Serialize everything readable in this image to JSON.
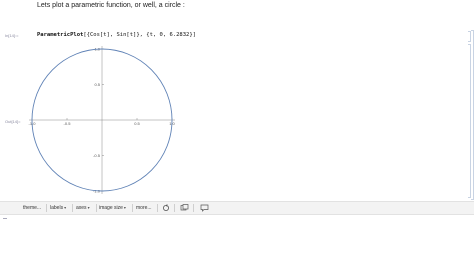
{
  "intro": {
    "text": "Lets plot a parametric function, or well, a circle :"
  },
  "input": {
    "label": "In[14]:=",
    "code_head": "ParametricPlot",
    "code_rest": "[{Cos[t], Sin[t]}, {t, 0, 6.2832}]"
  },
  "output": {
    "label": "Out[14]="
  },
  "chart_data": {
    "type": "line",
    "series": [
      {
        "x": [
          1,
          0.924,
          0.707,
          0.383,
          0,
          -0.383,
          -0.707,
          -0.924,
          -1,
          -0.924,
          -0.707,
          -0.383,
          0,
          0.383,
          0.707,
          0.924,
          1
        ],
        "y": [
          0,
          0.383,
          0.707,
          0.924,
          1,
          0.924,
          0.707,
          0.383,
          0,
          -0.383,
          -0.707,
          -0.924,
          -1,
          -0.924,
          -0.707,
          -0.383,
          0
        ]
      }
    ],
    "xlim": [
      -1,
      1
    ],
    "ylim": [
      -1,
      1
    ],
    "xticks": [
      -1.0,
      -0.5,
      0.5,
      1.0
    ],
    "yticks": [
      -1.0,
      -0.5,
      0.5,
      1.0
    ],
    "xtick_labels": [
      "-1.0",
      "-0.5",
      "0.5",
      "1.0"
    ],
    "ytick_labels": [
      "-1.0",
      "-0.5",
      "0.5",
      "1.0"
    ],
    "title": "",
    "xlabel": "",
    "ylabel": "",
    "grid": false,
    "line_color": "#5e81b5"
  },
  "toolbar": {
    "theme": "theme...",
    "labels": "labels",
    "axes": "axes",
    "image_size": "image size",
    "more": "more..."
  },
  "colors": {
    "curve": "#5e81b5",
    "axis": "#888888",
    "toolbar_bg": "#f3f3f3"
  },
  "icons": {
    "toolbar_icon_1": "rotate-icon",
    "toolbar_icon_2": "copy-icon",
    "toolbar_icon_3": "comment-icon"
  }
}
